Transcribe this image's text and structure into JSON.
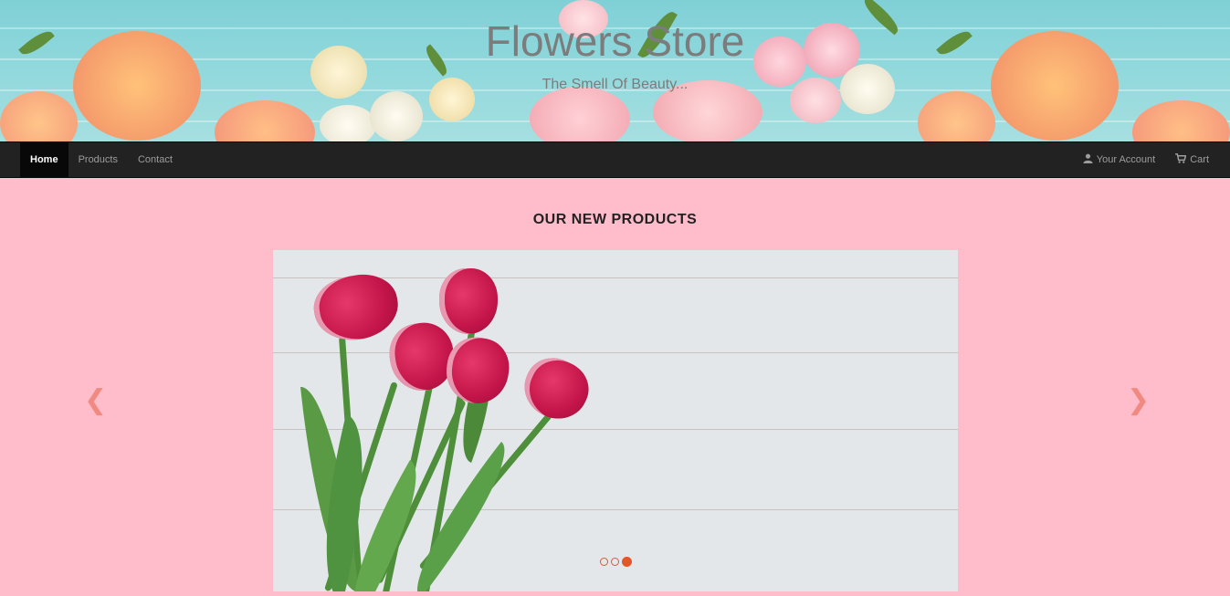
{
  "banner": {
    "title": "Flowers Store",
    "subtitle": "The Smell Of Beauty..."
  },
  "navbar": {
    "left_items": [
      {
        "label": "Home",
        "active": true
      },
      {
        "label": "Products",
        "active": false
      },
      {
        "label": "Contact",
        "active": false
      }
    ],
    "right_items": [
      {
        "label": "Your Account",
        "icon": "user-icon"
      },
      {
        "label": "Cart",
        "icon": "cart-icon"
      }
    ]
  },
  "main": {
    "section_title": "OUR NEW PRODUCTS",
    "carousel": {
      "slide_count": 3,
      "active_slide": 3,
      "prev_icon": "chevron-left-icon",
      "next_icon": "chevron-right-icon"
    }
  },
  "colors": {
    "page_background": "#ffbccb",
    "navbar_background": "#222222",
    "accent": "#e0572d",
    "arrow": "#f08a80"
  }
}
